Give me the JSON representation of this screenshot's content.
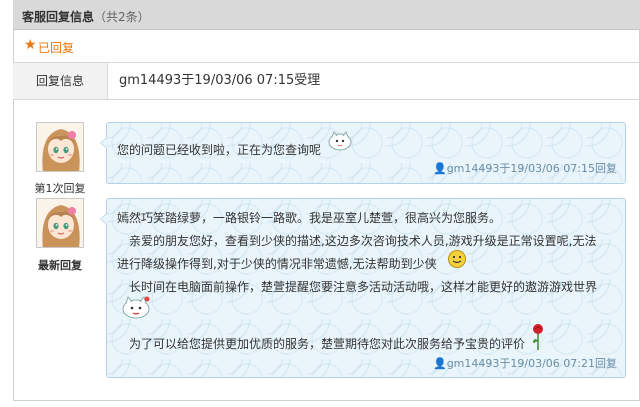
{
  "header": {
    "title": "客服回复信息",
    "count": "（共2条）"
  },
  "status": {
    "label": "已回复",
    "icon": "star-icon",
    "color": "#e8760d"
  },
  "reply_info": {
    "label": "回复信息",
    "value": "gm14493于19/03/06 07:15受理"
  },
  "messages": [
    {
      "avatar_caption": "第1次回复",
      "lines": [
        "您的问题已经收到啦，正在为您查询呢"
      ],
      "meta": "gm14493于19/03/06 07:15回复"
    },
    {
      "avatar_caption": "最新回复",
      "lines": [
        "嫣然巧笑踏绿萝，一路银铃一路歌。我是巫室儿楚萱，很高兴为您服务。",
        "亲爱的朋友您好，查看到少侠的描述,这边多次咨询技术人员,游戏升级是正常设置呢,无法",
        "进行降级操作得到,对于少侠的情况非常遗憾,无法帮助到少侠",
        "长时间在电脑面前操作，楚萱提醒您要注意多活动活动哦，这样才能更好的遨游游戏世界",
        "为了可以给您提供更加优质的服务，楚萱期待您对此次服务给予宝贵的评价"
      ],
      "meta": "gm14493于19/03/06 07:21回复"
    }
  ],
  "colors": {
    "accent": "#e8760d",
    "bubble_bg": "#e9f5fb",
    "bubble_border": "#b7d2e6",
    "meta_text": "#6a8da5"
  }
}
